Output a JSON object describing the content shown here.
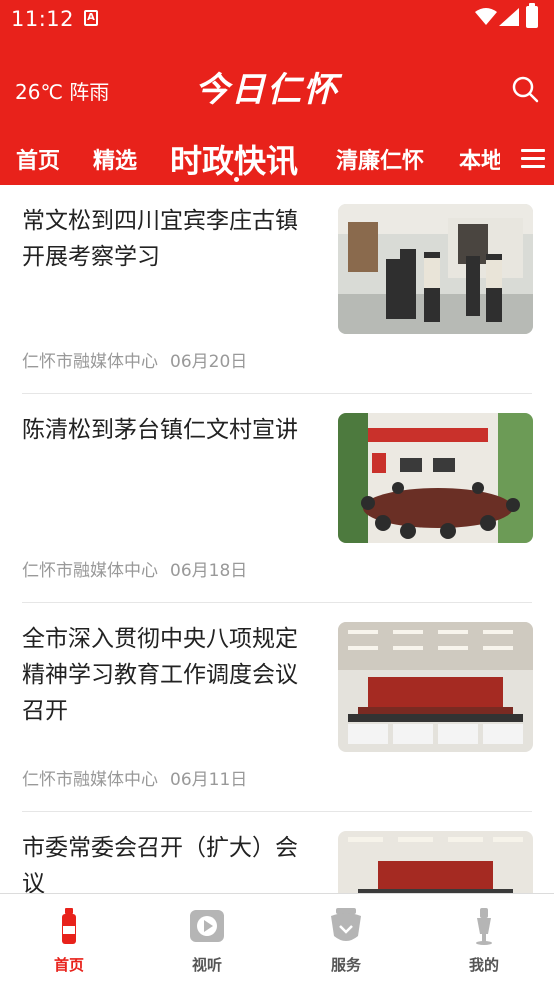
{
  "status_bar": {
    "time": "11:12"
  },
  "header": {
    "weather": "26℃ 阵雨",
    "logo": "今日仁怀"
  },
  "tabs": [
    {
      "label": "首页"
    },
    {
      "label": "精选"
    },
    {
      "label": "时政快讯",
      "active": true
    },
    {
      "label": "清廉仁怀"
    },
    {
      "label": "本地"
    }
  ],
  "news": [
    {
      "title": "常文松到四川宜宾李庄古镇开展考察学习",
      "source": "仁怀市融媒体中心",
      "date": "06月20日"
    },
    {
      "title": "陈清松到茅台镇仁文村宣讲",
      "source": "仁怀市融媒体中心",
      "date": "06月18日"
    },
    {
      "title": "全市深入贯彻中央八项规定精神学习教育工作调度会议召开",
      "source": "仁怀市融媒体中心",
      "date": "06月11日"
    },
    {
      "title": "市委常委会召开（扩大）会议",
      "source": "",
      "date": ""
    }
  ],
  "bottom_nav": [
    {
      "label": "首页",
      "icon": "home-bottle-icon",
      "active": true
    },
    {
      "label": "视听",
      "icon": "play-icon"
    },
    {
      "label": "服务",
      "icon": "service-icon"
    },
    {
      "label": "我的",
      "icon": "profile-icon"
    }
  ],
  "colors": {
    "brand_red": "#e8221b",
    "muted_text": "#999999",
    "title_text": "#222222"
  }
}
